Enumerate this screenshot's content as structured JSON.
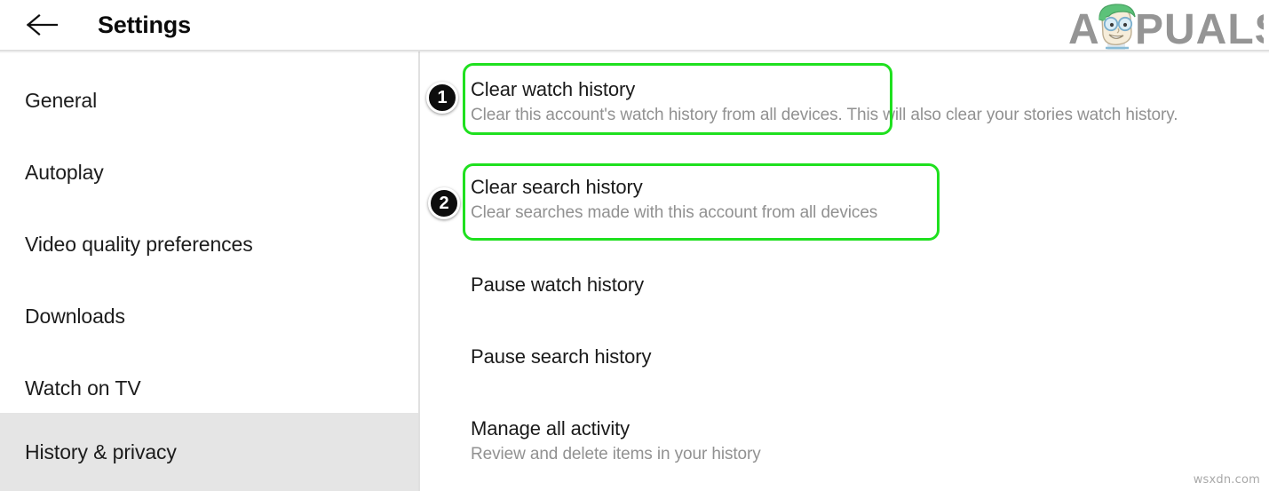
{
  "header": {
    "back_icon": "back-arrow-icon",
    "title": "Settings",
    "brand": {
      "text_a": "A",
      "text_rest": "PUALS",
      "mascot": "appuals-mascot-icon"
    }
  },
  "sidebar": {
    "items": [
      {
        "label": "General",
        "active": false
      },
      {
        "label": "Autoplay",
        "active": false
      },
      {
        "label": "Video quality preferences",
        "active": false
      },
      {
        "label": "Downloads",
        "active": false
      },
      {
        "label": "Watch on TV",
        "active": false
      },
      {
        "label": "History & privacy",
        "active": true
      }
    ]
  },
  "main": {
    "rows": [
      {
        "id": "clear-watch",
        "title": "Clear watch history",
        "subtitle": "Clear this account's watch history from all devices. This will also clear your stories watch history."
      },
      {
        "id": "clear-search",
        "title": "Clear search history",
        "subtitle": "Clear searches made with this account from all devices"
      },
      {
        "id": "pause-watch",
        "title": "Pause watch history",
        "subtitle": ""
      },
      {
        "id": "pause-search",
        "title": "Pause search history",
        "subtitle": ""
      },
      {
        "id": "manage",
        "title": "Manage all activity",
        "subtitle": "Review and delete items in your history"
      }
    ]
  },
  "annotations": {
    "badges": [
      {
        "number": "1"
      },
      {
        "number": "2"
      }
    ],
    "highlight_color": "#1fe01f"
  },
  "watermark": {
    "text": "wsxdn.com"
  },
  "colors": {
    "accent_green": "#1fe01f",
    "sidebar_active_bg": "#e5e5e5",
    "title_text": "#1a1a1a",
    "subtitle_text": "#919191",
    "badge_bg": "#0d0d0d"
  }
}
